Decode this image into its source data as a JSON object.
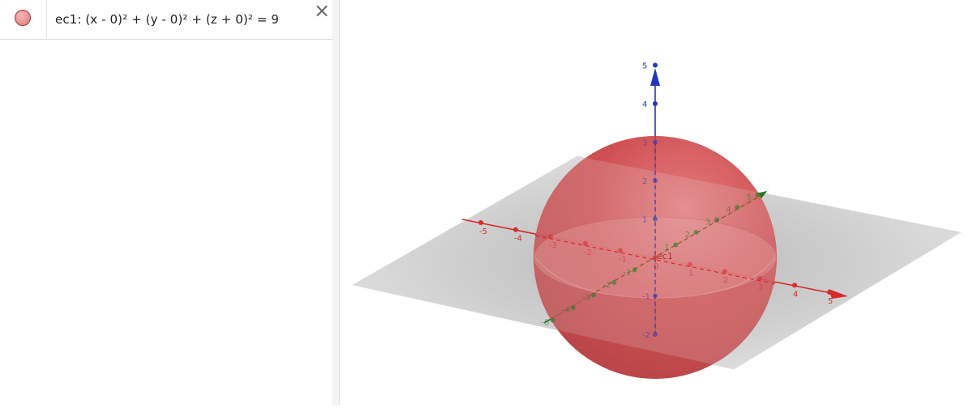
{
  "algebra_view": {
    "items": [
      {
        "equation": "ec1: (x - 0)² + (y - 0)² + (z + 0)² = 9",
        "color": "#e88f8f"
      }
    ],
    "close_symbol": "×"
  },
  "graphics_3d": {
    "object_label": "ec1",
    "colors": {
      "sphere": "#c9393c",
      "x_axis": "#d62b2b",
      "y_axis": "#1f7a1f",
      "z_axis": "#2535c0",
      "plane": "#9a9a9a"
    },
    "x_axis_ticks": [
      "-5",
      "-4",
      "-3",
      "-2",
      "-1",
      "0",
      "1",
      "2",
      "3",
      "4",
      "5"
    ],
    "y_axis_ticks": [
      "-5",
      "-4",
      "-3",
      "-2",
      "-1",
      "1",
      "2",
      "3",
      "4",
      "5"
    ],
    "z_axis_ticks": [
      "-2",
      "-1",
      "1",
      "2",
      "3",
      "4",
      "5"
    ],
    "icons": [
      "close-icon",
      "visibility-marble-icon"
    ]
  }
}
